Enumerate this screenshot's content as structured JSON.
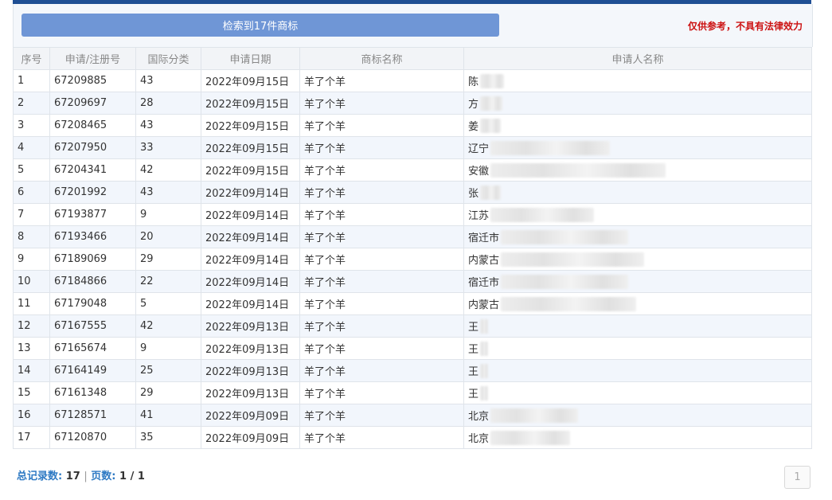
{
  "header": {
    "count_label": "检索到17件商标",
    "disclaimer": "仅供参考，不具有法律效力"
  },
  "columns": [
    "序号",
    "申请/注册号",
    "国际分类",
    "申请日期",
    "商标名称",
    "申请人名称"
  ],
  "rows": [
    {
      "no": "1",
      "reg": "67209885",
      "cls": "43",
      "date": "2022年09月15日",
      "mark": "羊了个羊",
      "applicant": "陈"
    },
    {
      "no": "2",
      "reg": "67209697",
      "cls": "28",
      "date": "2022年09月15日",
      "mark": "羊了个羊",
      "applicant": "方"
    },
    {
      "no": "3",
      "reg": "67208465",
      "cls": "43",
      "date": "2022年09月15日",
      "mark": "羊了个羊",
      "applicant": "姜"
    },
    {
      "no": "4",
      "reg": "67207950",
      "cls": "33",
      "date": "2022年09月15日",
      "mark": "羊了个羊",
      "applicant": "辽宁"
    },
    {
      "no": "5",
      "reg": "67204341",
      "cls": "42",
      "date": "2022年09月15日",
      "mark": "羊了个羊",
      "applicant": "安徽"
    },
    {
      "no": "6",
      "reg": "67201992",
      "cls": "43",
      "date": "2022年09月14日",
      "mark": "羊了个羊",
      "applicant": "张"
    },
    {
      "no": "7",
      "reg": "67193877",
      "cls": "9",
      "date": "2022年09月14日",
      "mark": "羊了个羊",
      "applicant": "江苏"
    },
    {
      "no": "8",
      "reg": "67193466",
      "cls": "20",
      "date": "2022年09月14日",
      "mark": "羊了个羊",
      "applicant": "宿迁市"
    },
    {
      "no": "9",
      "reg": "67189069",
      "cls": "29",
      "date": "2022年09月14日",
      "mark": "羊了个羊",
      "applicant": "内蒙古"
    },
    {
      "no": "10",
      "reg": "67184866",
      "cls": "22",
      "date": "2022年09月14日",
      "mark": "羊了个羊",
      "applicant": "宿迁市"
    },
    {
      "no": "11",
      "reg": "67179048",
      "cls": "5",
      "date": "2022年09月14日",
      "mark": "羊了个羊",
      "applicant": "内蒙古"
    },
    {
      "no": "12",
      "reg": "67167555",
      "cls": "42",
      "date": "2022年09月13日",
      "mark": "羊了个羊",
      "applicant": "王"
    },
    {
      "no": "13",
      "reg": "67165674",
      "cls": "9",
      "date": "2022年09月13日",
      "mark": "羊了个羊",
      "applicant": "王"
    },
    {
      "no": "14",
      "reg": "67164149",
      "cls": "25",
      "date": "2022年09月13日",
      "mark": "羊了个羊",
      "applicant": "王"
    },
    {
      "no": "15",
      "reg": "67161348",
      "cls": "29",
      "date": "2022年09月13日",
      "mark": "羊了个羊",
      "applicant": "王"
    },
    {
      "no": "16",
      "reg": "67128571",
      "cls": "41",
      "date": "2022年09月09日",
      "mark": "羊了个羊",
      "applicant": "北京"
    },
    {
      "no": "17",
      "reg": "67120870",
      "cls": "35",
      "date": "2022年09月09日",
      "mark": "羊了个羊",
      "applicant": "北京"
    }
  ],
  "footer": {
    "total_label": "总记录数:",
    "total_value": "17",
    "separator": "|",
    "pages_label": "页数:",
    "pages_value": "1 / 1",
    "page_button": "1"
  },
  "colors": {
    "top_bar": "#1f4f94",
    "count_button": "#6f96d6",
    "disclaimer": "#cc1111",
    "link": "#2c78c9"
  }
}
